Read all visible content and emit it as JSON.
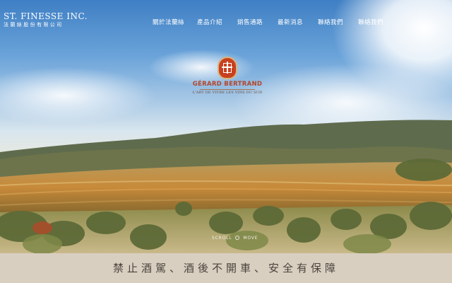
{
  "header": {
    "brand_en": "ST. FINESSE INC.",
    "brand_zh": "法蘭絲股份有限公司"
  },
  "nav": {
    "items": [
      {
        "label": "關於法蘭絲"
      },
      {
        "label": "產品介紹"
      },
      {
        "label": "銷售通路"
      },
      {
        "label": "最新消息"
      },
      {
        "label": "聯絡我們"
      },
      {
        "label": "聯絡我們"
      }
    ]
  },
  "hero_logo": {
    "name": "GÉRARD BERTRAND",
    "tagline": "L'ART DE VIVRE LES VINS DU SUD"
  },
  "scroll_hint": {
    "left": "SCROLL",
    "right": "MOVE"
  },
  "footer": {
    "warning": "禁止酒駕、酒後不開車、安全有保障"
  },
  "colors": {
    "footer_bg": "#d8cfc1",
    "logo_red": "#b5462b",
    "nav_text": "#ffffff"
  }
}
